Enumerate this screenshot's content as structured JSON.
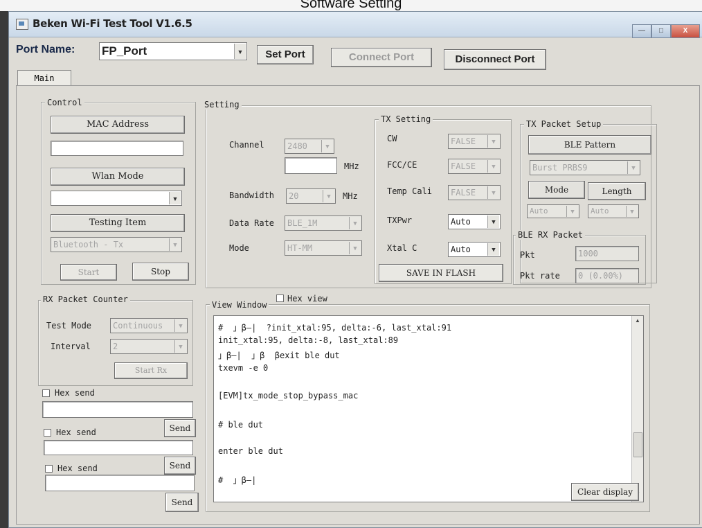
{
  "caption": "Software Setting",
  "window": {
    "title": "Beken Wi-Fi Test Tool V1.6.5",
    "min": "—",
    "max": "□",
    "close": "X"
  },
  "port": {
    "label": "Port Name:",
    "value": "FP_Port",
    "set_label": "Set Port",
    "connect_label": "Connect Port",
    "disconnect_label": "Disconnect Port"
  },
  "tabs": [
    "Main"
  ],
  "control": {
    "title": "Control",
    "mac_label": "MAC Address",
    "mac_value": "",
    "wlan_mode_label": "Wlan Mode",
    "wlan_mode_value": "",
    "testing_item_label": "Testing Item",
    "testing_item_value": "Bluetooth - Tx",
    "start_label": "Start",
    "stop_label": "Stop"
  },
  "setting": {
    "title": "Setting",
    "channel_label": "Channel",
    "channel_value": "2480",
    "freq_value": "",
    "mhz1": "MHz",
    "bandwidth_label": "Bandwidth",
    "bandwidth_value": "20",
    "mhz2": "MHz",
    "datarate_label": "Data Rate",
    "datarate_value": "BLE_1M",
    "mode_label": "Mode",
    "mode_value": "HT-MM"
  },
  "tx_setting": {
    "title": "TX Setting",
    "cw_label": "CW",
    "cw_value": "FALSE",
    "fcc_label": "FCC/CE",
    "fcc_value": "FALSE",
    "temp_label": "Temp Cali",
    "temp_value": "FALSE",
    "txpwr_label": "TXPwr",
    "txpwr_value": "Auto",
    "xtal_label": "Xtal C",
    "xtal_value": "Auto",
    "save_label": "SAVE IN FLASH"
  },
  "tx_packet": {
    "title": "TX Packet Setup",
    "pattern_label": "BLE Pattern",
    "pattern_value": "Burst PRBS9",
    "mode_label": "Mode",
    "length_label": "Length",
    "mode_value": "Auto",
    "length_value": "Auto"
  },
  "ble_rx": {
    "title": "BLE RX Packet",
    "pkt_label": "Pkt",
    "pkt_value": "1000",
    "rate_label": "Pkt rate",
    "rate_value": "0 (0.00%)"
  },
  "rx_counter": {
    "title": "RX Packet Counter",
    "test_mode_label": "Test Mode",
    "test_mode_value": "Continuous",
    "interval_label": "Interval",
    "interval_value": "2",
    "start_label": "Start Rx"
  },
  "hex_sends": [
    {
      "check_label": "Hex send",
      "send_label": "Send"
    },
    {
      "check_label": "Hex send",
      "send_label": "Send"
    },
    {
      "check_label": "Hex send",
      "send_label": "Send"
    }
  ],
  "view": {
    "title": "View Window",
    "hex_view_label": "Hex view",
    "lines": [
      "#  」β—|  ?init_xtal:95, delta:-6, last_xtal:91",
      "init_xtal:95, delta:-8, last_xtal:89",
      "」β—|  」β  βexit ble dut",
      "txevm -e 0",
      "",
      "[EVM]tx_mode_stop_bypass_mac",
      "",
      "# ble dut",
      "",
      "enter ble dut",
      "",
      "#  」β—|"
    ],
    "clear_label": "Clear display"
  }
}
